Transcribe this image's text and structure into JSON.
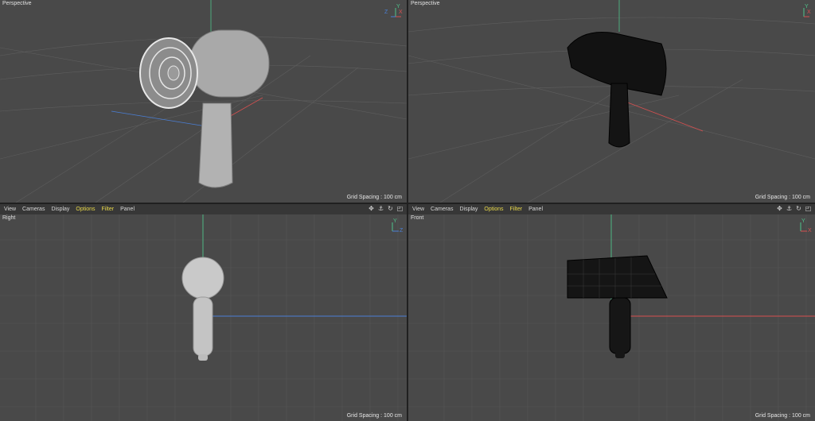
{
  "viewports": {
    "top_left": {
      "label": "Perspective",
      "grid_spacing": "Grid Spacing : 100 cm",
      "axes": [
        "Z",
        "Y",
        "X"
      ]
    },
    "top_right": {
      "label": "Perspective",
      "grid_spacing": "Grid Spacing : 100 cm",
      "axes": [
        "Y",
        "X"
      ]
    },
    "bottom_left": {
      "label": "Right",
      "grid_spacing": "Grid Spacing : 100 cm",
      "axes": [
        "Y",
        "Z"
      ]
    },
    "bottom_right": {
      "label": "Front",
      "grid_spacing": "Grid Spacing : 100 cm",
      "axes": [
        "Y",
        "X"
      ]
    }
  },
  "menu": {
    "items": [
      "View",
      "Cameras",
      "Display",
      "Options",
      "Filter",
      "Panel"
    ],
    "highlighted": [
      "Options",
      "Filter"
    ]
  },
  "colors": {
    "axis_x": "#d85050",
    "axis_y": "#4fc28a",
    "axis_z": "#4a7fd6",
    "highlight": "#e8d84a"
  },
  "icons": [
    "move-icon",
    "pan-icon",
    "rotate-icon",
    "maximize-icon"
  ]
}
